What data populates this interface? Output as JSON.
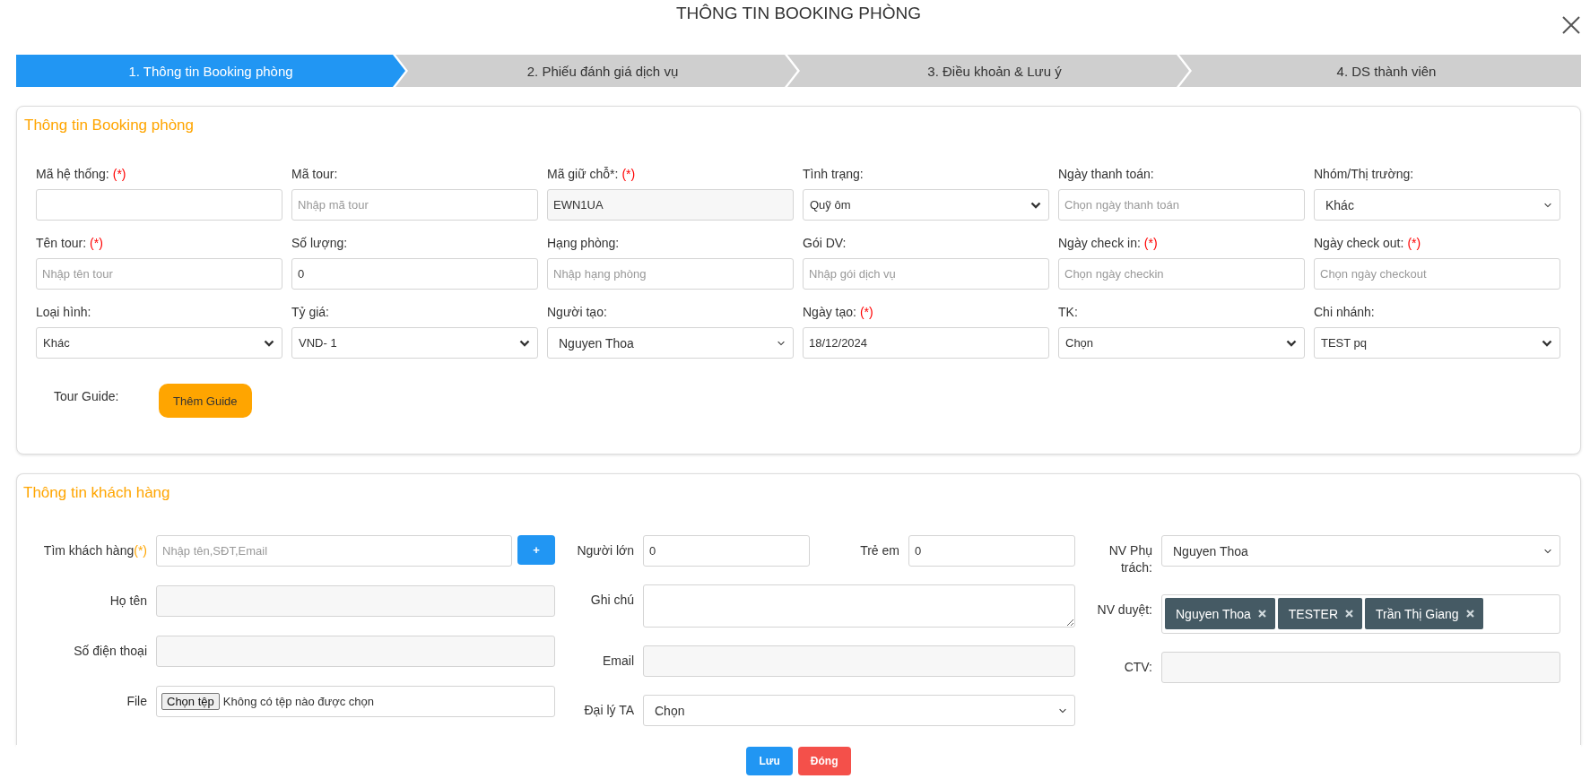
{
  "dialog_title": "THÔNG TIN BOOKING PHÒNG",
  "steps": [
    {
      "label": "1. Thông tin Booking phòng",
      "selected": true
    },
    {
      "label": "2. Phiếu đánh giá dịch vụ",
      "selected": false
    },
    {
      "label": "3. Điều khoản & Lưu ý",
      "selected": false
    },
    {
      "label": "4. DS thành viên",
      "selected": false
    }
  ],
  "booking": {
    "title": "Thông tin Booking phòng",
    "fields": [
      {
        "label": "Mã hệ thống:",
        "mark": "(*)",
        "kind": "input"
      },
      {
        "label": "Mã tour:",
        "kind": "input",
        "placeholder": "Nhập mã tour"
      },
      {
        "label": "Mã giữ chỗ*:",
        "mark": "(*)",
        "kind": "readonly",
        "value": "EWN1UA"
      },
      {
        "label": "Tình trạng:",
        "kind": "select",
        "value": "Quỹ ôm"
      },
      {
        "label": "Ngày thanh toán:",
        "kind": "input",
        "placeholder": "Chọn ngày thanh toán"
      },
      {
        "label": "Nhóm/Thị trường:",
        "kind": "dropdown",
        "value": "Khác"
      },
      {
        "label": "Tên tour:",
        "mark": "(*)",
        "kind": "input",
        "placeholder": "Nhập tên tour"
      },
      {
        "label": "Số lượng:",
        "kind": "input",
        "value": "0"
      },
      {
        "label": "Hạng phòng:",
        "kind": "input",
        "placeholder": "Nhập hạng phòng"
      },
      {
        "label": "Gói DV:",
        "kind": "input",
        "placeholder": "Nhập gói dịch vụ"
      },
      {
        "label": "Ngày check in:",
        "mark": "(*)",
        "kind": "input",
        "placeholder": "Chọn ngày checkin"
      },
      {
        "label": "Ngày check out:",
        "mark": "(*)",
        "kind": "input",
        "placeholder": "Chọn ngày checkout"
      },
      {
        "label": "Loại hình:",
        "kind": "select",
        "value": "Khác"
      },
      {
        "label": "Tỷ giá:",
        "kind": "select",
        "value": "VND- 1"
      },
      {
        "label": "Người tạo:",
        "kind": "dropdown",
        "value": "Nguyen Thoa"
      },
      {
        "label": "Ngày tạo:",
        "mark": "(*)",
        "kind": "input",
        "value": "18/12/2024"
      },
      {
        "label": "TK:",
        "kind": "select",
        "value": "Chọn"
      },
      {
        "label": "Chi nhánh:",
        "kind": "select",
        "value": "TEST pq"
      }
    ],
    "tour_guide": {
      "label": "Tour Guide:",
      "button": "Thêm Guide"
    }
  },
  "customer": {
    "title": "Thông tin khách hàng",
    "columns": [
      [
        {
          "label": "Tìm khách hàng",
          "mark": "(*)",
          "kind": "search",
          "placeholder": "Nhập tên,SĐT,Email",
          "button": "+"
        },
        {
          "label": "Họ tên",
          "kind": "readonly"
        },
        {
          "label": "Số điện thoại",
          "kind": "readonly"
        },
        {
          "label": "File",
          "kind": "file",
          "button": "Chọn tệp",
          "value": "Không có tệp nào được chọn"
        }
      ],
      [
        {
          "label": "Người lớn",
          "kind": "input",
          "value": "0",
          "second_label": "Trẻ em",
          "second_value": "0"
        },
        {
          "label": "Ghi chú",
          "kind": "textarea"
        },
        {
          "label": "Email",
          "kind": "readonly"
        },
        {
          "label": "Đại lý TA",
          "kind": "dropdown",
          "value": "Chọn"
        }
      ],
      [
        {
          "label": "NV Phụ trách:",
          "kind": "dropdown",
          "value": "Nguyen Thoa"
        },
        {
          "label": "NV duyệt:",
          "kind": "tags",
          "tags": [
            "Nguyen Thoa",
            "TESTER",
            "Trần Thị Giang"
          ]
        },
        {
          "label": "CTV:",
          "kind": "readonly"
        }
      ]
    ]
  },
  "buttons": [
    {
      "label": "Lưu",
      "kind": "primary"
    },
    {
      "label": "Đóng",
      "kind": "danger"
    }
  ]
}
